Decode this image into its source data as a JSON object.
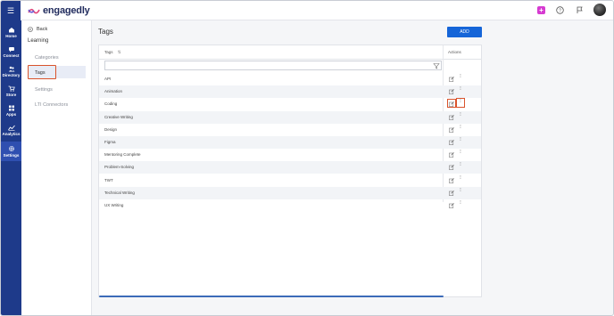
{
  "app": {
    "brand": "engagedly",
    "menu_icon": "hamburger-icon"
  },
  "topbar": {
    "icons": [
      "plus-square-icon",
      "help-circle-icon",
      "flag-icon",
      "avatar"
    ]
  },
  "leftnav": {
    "items": [
      {
        "label": "Home",
        "icon": "home-icon"
      },
      {
        "label": "Connect",
        "icon": "chat-icon"
      },
      {
        "label": "Directory",
        "icon": "people-icon"
      },
      {
        "label": "Store",
        "icon": "cart-icon"
      },
      {
        "label": "Apps",
        "icon": "apps-icon"
      },
      {
        "label": "Analytics",
        "icon": "chart-icon"
      },
      {
        "label": "Settings",
        "icon": "gear-icon"
      }
    ],
    "active": "Settings"
  },
  "submenu": {
    "back_label": "Back",
    "section_title": "Learning",
    "items": [
      {
        "label": "Categories"
      },
      {
        "label": "Tags"
      },
      {
        "label": "Settings"
      },
      {
        "label": "LTI Connectors"
      }
    ],
    "active": "Tags"
  },
  "main": {
    "title": "Tags",
    "add_label": "ADD",
    "table": {
      "col_tags": "Tags",
      "col_actions": "Actions",
      "rows": [
        "API",
        "Animation",
        "Coding",
        "Creative Writing",
        "Design",
        "Figma",
        "Mentoring Complete",
        "Problem-Solving",
        "TWT",
        "Technical Writing",
        "UX Writing"
      ]
    }
  },
  "colors": {
    "nav_bg": "#1e3a8a",
    "accent": "#1565d8",
    "highlight": "#d9532c"
  }
}
